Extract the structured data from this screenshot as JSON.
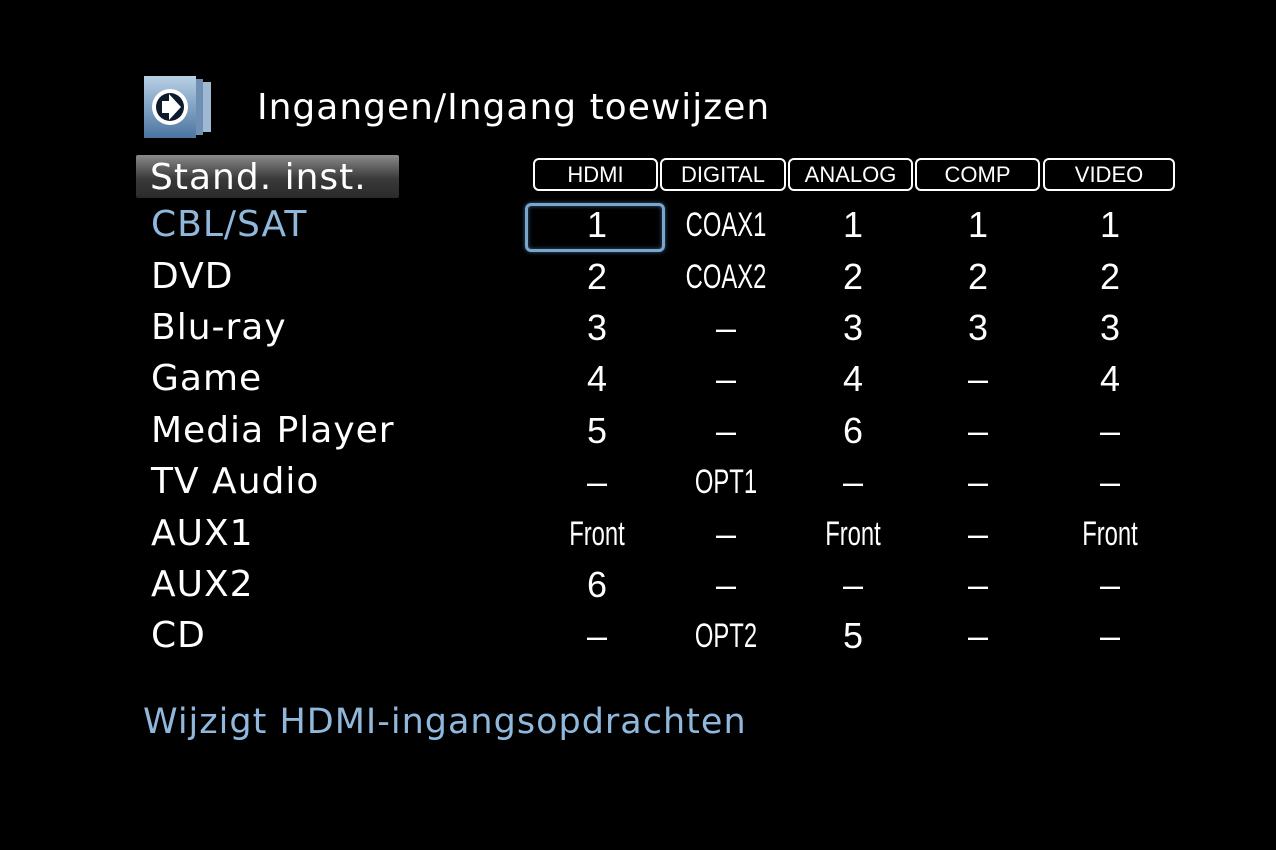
{
  "header": {
    "title": "Ingangen/Ingang toewijzen",
    "icon": "arrow-right-circle-icon"
  },
  "default_button": {
    "label": "Stand. inst."
  },
  "columns": [
    "HDMI",
    "DIGITAL",
    "ANALOG",
    "COMP",
    "VIDEO"
  ],
  "rows": [
    {
      "label": "CBL/SAT",
      "cells": [
        "1",
        "COAX1",
        "1",
        "1",
        "1"
      ]
    },
    {
      "label": "DVD",
      "cells": [
        "2",
        "COAX2",
        "2",
        "2",
        "2"
      ]
    },
    {
      "label": "Blu-ray",
      "cells": [
        "3",
        "–",
        "3",
        "3",
        "3"
      ]
    },
    {
      "label": "Game",
      "cells": [
        "4",
        "–",
        "4",
        "–",
        "4"
      ]
    },
    {
      "label": "Media Player",
      "cells": [
        "5",
        "–",
        "6",
        "–",
        "–"
      ]
    },
    {
      "label": "TV Audio",
      "cells": [
        "–",
        "OPT1",
        "–",
        "–",
        "–"
      ]
    },
    {
      "label": "AUX1",
      "cells": [
        "Front",
        "–",
        "Front",
        "–",
        "Front"
      ]
    },
    {
      "label": "AUX2",
      "cells": [
        "6",
        "–",
        "–",
        "–",
        "–"
      ]
    },
    {
      "label": "CD",
      "cells": [
        "–",
        "OPT2",
        "5",
        "–",
        "–"
      ]
    }
  ],
  "selected": {
    "row": 0,
    "column": 0
  },
  "footer": {
    "hint": "Wijzigt HDMI-ingangsopdrachten"
  },
  "colors": {
    "background": "#000000",
    "text": "#ffffff",
    "accent": "#8fb8dc",
    "cursor": "#7aa6cc"
  }
}
